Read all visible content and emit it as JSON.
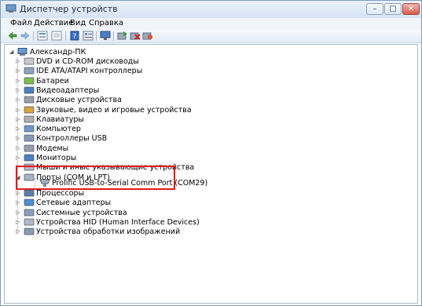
{
  "window": {
    "title": "Диспетчер устройств"
  },
  "menu": [
    "Файл",
    "Действие",
    "Вид",
    "Справка"
  ],
  "toolbar": {
    "buttons": [
      "back-arrow-icon",
      "forward-arrow-icon",
      "tree-view-icon",
      "list-view-icon",
      "help-book-icon",
      "properties-icon",
      "monitor-icon",
      "update-driver-icon",
      "disable-device-icon",
      "uninstall-device-icon"
    ]
  },
  "tree": {
    "root": "Александр-ПК",
    "categories": [
      "DVD и CD-ROM дисководы",
      "IDE ATA/ATAPI контроллеры",
      "Батареи",
      "Видеоадаптеры",
      "Дисковые устройства",
      "Звуковые, видео и игровые устройства",
      "Клавиатуры",
      "Компьютер",
      "Контроллеры USB",
      "Модемы",
      "Мониторы",
      "Мыши и иные указывающие устройства",
      "Порты (COM и LPT)",
      "Процессоры",
      "Сетевые адаптеры",
      "Системные устройства",
      "Устройства HID (Human Interface Devices)",
      "Устройства обработки изображений"
    ],
    "ports_child": "Prolific USB-to-Serial Comm Port (COM29)"
  },
  "colors": {
    "highlight": "#e3191b",
    "titlebar": "#d6e4f5"
  }
}
